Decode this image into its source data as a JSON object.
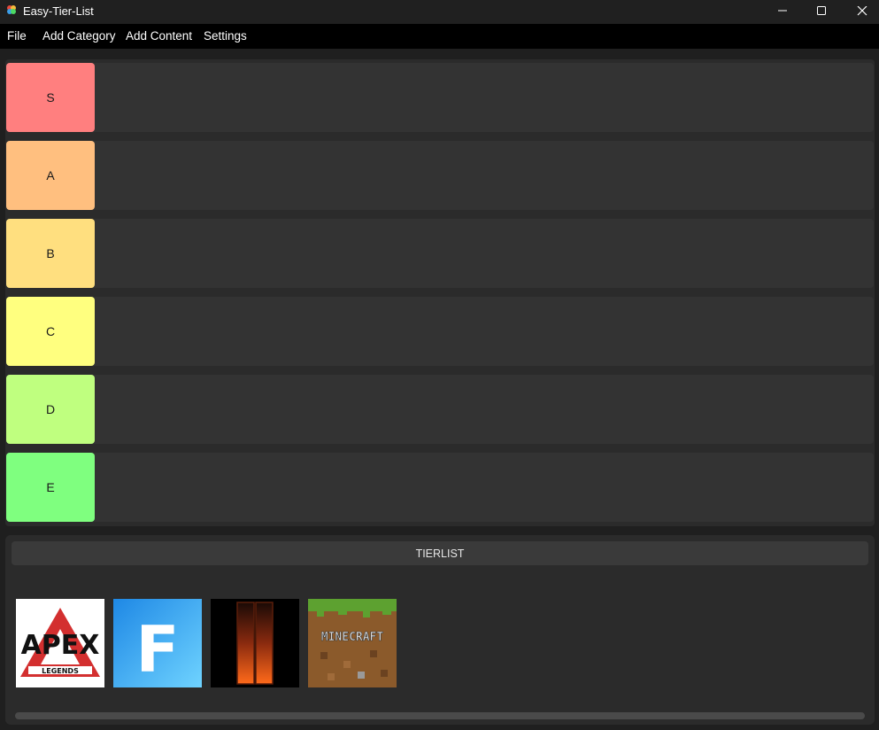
{
  "window": {
    "title": "Easy-Tier-List",
    "controls": [
      "minimize-icon",
      "maximize-icon",
      "close-icon"
    ]
  },
  "menu": {
    "items": [
      "File",
      "Add Category",
      "Add Content",
      "Settings"
    ]
  },
  "tiers": [
    {
      "label": "S",
      "color": "#ff7f7f"
    },
    {
      "label": "A",
      "color": "#ffbf7f"
    },
    {
      "label": "B",
      "color": "#ffdf7f"
    },
    {
      "label": "C",
      "color": "#ffff7f"
    },
    {
      "label": "D",
      "color": "#bfff7f"
    },
    {
      "label": "E",
      "color": "#7fff7f"
    }
  ],
  "pool": {
    "header": "TIERLIST",
    "items": [
      {
        "name": "apex-legends-logo",
        "logo_text": "APEX",
        "logo_subtext": "LEGENDS"
      },
      {
        "name": "fortnite-logo",
        "logo_text": "F"
      },
      {
        "name": "black-ops-logo"
      },
      {
        "name": "minecraft-logo",
        "logo_text": "MINECRAFT"
      }
    ]
  }
}
